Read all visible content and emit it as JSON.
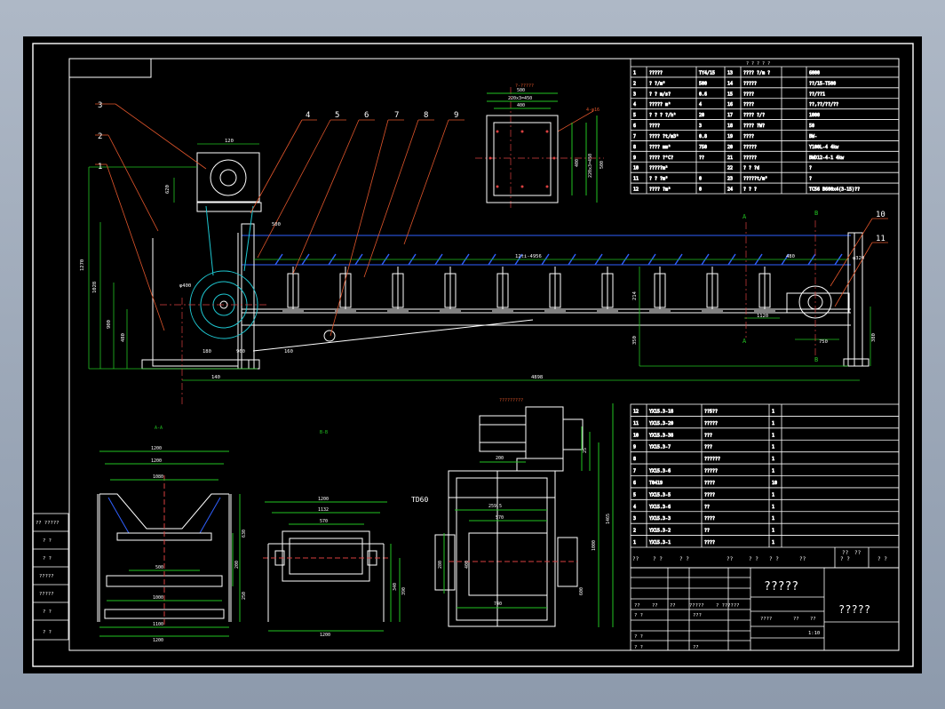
{
  "colors": {
    "background": "#000000",
    "frame": "#ffffff",
    "structure": "#ffffff",
    "dimension": "#22c322",
    "leader": "#e0552b",
    "center": "#d94040",
    "belt": "#3060ff",
    "motor": "#1ec8d2",
    "title": "#ffffff"
  },
  "section_titles": {
    "top_view": "?-?????",
    "section_aa": "A-A",
    "section_bb": "B-B",
    "drive_view": "?????????",
    "drive_label": "TD60"
  },
  "part_numbers": [
    "1",
    "2",
    "3",
    "4",
    "5",
    "6",
    "7",
    "8",
    "9",
    "10",
    "11"
  ],
  "section_marks": {
    "a": "A",
    "b": "B"
  },
  "main_dims": {
    "belt_span": "12ti-4956",
    "total_length": "4898",
    "h1": "1270",
    "h2": "1028",
    "h3": "900",
    "h4": "480",
    "h5": "314",
    "d1": "180",
    "d2": "960",
    "d3": "160",
    "d4": "140",
    "d5": "350",
    "d6": "214",
    "d7": "380",
    "drum_top": "620",
    "drum_dia": "φ400",
    "tail_dia": "φ320",
    "tail_w": "750",
    "pitch": "1120",
    "span_r": "480",
    "top_w": "120",
    "g1": "500"
  },
  "top_view_dims": {
    "w1": "500",
    "w2": "220x3=450",
    "w3": "400",
    "h1": "400",
    "h2": "220x3=450",
    "h3": "500",
    "angle": "4-φ16"
  },
  "aa_dims": {
    "w1": "1200",
    "w2": "1200",
    "w3": "1080",
    "w4": "500",
    "w5": "1000",
    "w6": "1100",
    "w7": "1200",
    "h1": "630",
    "h2": "200",
    "h3": "250"
  },
  "bb_dims": {
    "w1": "1200",
    "w2": "1132",
    "w3": "570",
    "w4": "1200",
    "h1": "340",
    "h2": "390"
  },
  "drive_dims": {
    "w1": "200",
    "w2": "259.5",
    "w3": "570",
    "w4": "740",
    "h1": "1465",
    "h2": "1000",
    "h3": "600",
    "h4": "400",
    "h5": "280",
    "h6": "25"
  },
  "spec_table": {
    "title": "? ? ? ? ?",
    "rows": [
      [
        "1",
        "?????",
        "TY4/15",
        "13",
        "???? ?/m ?",
        "6000"
      ],
      [
        "2",
        "?  ?/m³",
        "500",
        "14",
        "?????",
        "??/15-T500"
      ],
      [
        "3",
        "?  ? m/s?",
        "0.6",
        "15",
        "????",
        "??/??1"
      ],
      [
        "4",
        "????? m²",
        "4",
        "16",
        "????",
        "??,??/??/??"
      ],
      [
        "5",
        "? ? ? ?/h²",
        "20",
        "17",
        "???? ?/?",
        "1000"
      ],
      [
        "6",
        "????",
        "3",
        "18",
        "???? ?W?",
        "50"
      ],
      [
        "7",
        "???? ?t/m3²",
        "0.8",
        "19",
        "????",
        "BW-"
      ],
      [
        "8",
        "???? mm²",
        "750",
        "20",
        "?????",
        "Y100L-4 4kw"
      ],
      [
        "9",
        "???? ?°C?",
        "??",
        "21",
        "?????",
        "BWD12-4-1 4kw"
      ],
      [
        "10",
        "?????m²",
        "",
        "22",
        "? ? ?d",
        "?"
      ],
      [
        "11",
        "? ? ?m³",
        "0",
        "23",
        "?????t/m³",
        "?"
      ],
      [
        "12",
        "???? ?m²",
        "0",
        "24",
        "? ? ?",
        "TC56 B600x4(3-15)??"
      ]
    ]
  },
  "parts_table": [
    [
      "12",
      "YX15.3-18",
      "??5??",
      "1"
    ],
    [
      "11",
      "YX15.3-20",
      "?????",
      "1"
    ],
    [
      "10",
      "YX15.3-38",
      "???",
      "1"
    ],
    [
      "9",
      "YX15.3-7",
      "???",
      "1"
    ],
    [
      "8",
      "",
      "??????",
      "1"
    ],
    [
      "7",
      "YX15.3-6",
      "?????",
      "1"
    ],
    [
      "6",
      "T0419",
      "????",
      "10"
    ],
    [
      "5",
      "YX15.3-5",
      "????",
      "1"
    ],
    [
      "4",
      "YX15.3-6",
      "??",
      "1"
    ],
    [
      "3",
      "YX15.3-3",
      "????",
      "1"
    ],
    [
      "2",
      "YX15.3-2",
      "??",
      "1"
    ],
    [
      "1",
      "YX15.3-1",
      "????",
      "1"
    ]
  ],
  "parts_header": [
    "??",
    "? ?",
    "? ?",
    "??",
    "? ?",
    "? ?",
    "??",
    "? ?"
  ],
  "title_block": {
    "name": "?????",
    "drawing_title": "?????",
    "scale": "1:10",
    "r1": [
      "??",
      "??",
      "??",
      "?????",
      "? ??????"
    ],
    "design": "? ?",
    "check": "? ?",
    "std": "? ?",
    "approve": "? ?",
    "date": "??",
    "weight": "????",
    "sheet": "??",
    "qty": "??",
    "mark": "???"
  },
  "side_table": [
    "?? ?????",
    "? ?",
    "? ?",
    "?????",
    "?????",
    "? ?",
    "? ?"
  ]
}
